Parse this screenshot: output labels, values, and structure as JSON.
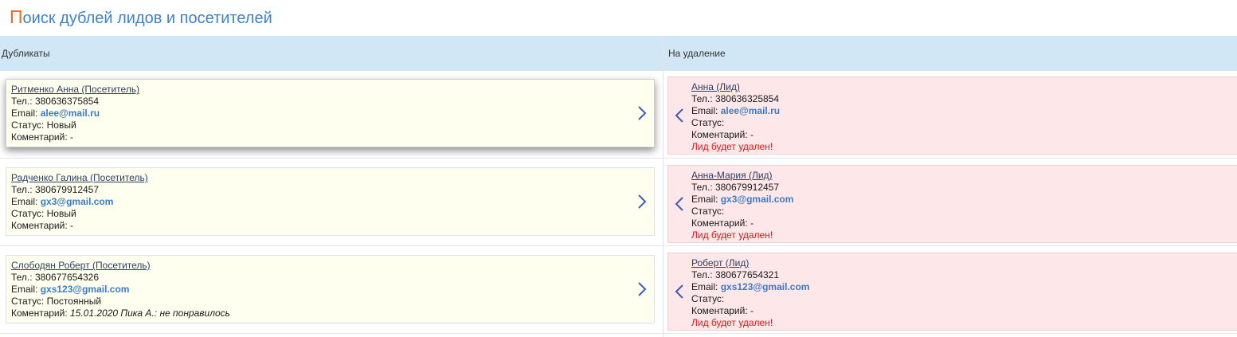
{
  "page": {
    "title_first": "П",
    "title_rest": "оиск дублей лидов и посетителей"
  },
  "header": {
    "duplicates": "Дубликаты",
    "to_delete": "На удаление"
  },
  "labels": {
    "phone": "Тел.: ",
    "email": "Email: ",
    "status": "Статус: ",
    "comment": "Коментарий: "
  },
  "rows": [
    {
      "duplicate": {
        "name": "Ритменко Анна (Посетитель)",
        "phone": "380636375854",
        "email": "alee@mail.ru",
        "status": "Новый",
        "comment": "-"
      },
      "deletion": {
        "name": "Анна (Лид)",
        "phone": "380636325854",
        "email": "alee@mail.ru",
        "status": "",
        "comment": "-",
        "warning": "Лид будет удален!"
      }
    },
    {
      "duplicate": {
        "name": "Радченко Галина (Посетитель)",
        "phone": "380679912457",
        "email": "gx3@gmail.com",
        "status": "Новый",
        "comment": "-"
      },
      "deletion": {
        "name": "Анна-Мария (Лид)",
        "phone": "380679912457",
        "email": "gx3@gmail.com",
        "status": "",
        "comment": "-",
        "warning": "Лид будет удален!"
      }
    },
    {
      "duplicate": {
        "name": "Слободян Роберт (Посетитель)",
        "phone": "380677654326",
        "email": "gxs123@gmail.com",
        "status": "Постоянный",
        "comment": "15.01.2020 Пика А.: не понравилось"
      },
      "deletion": {
        "name": "Роберт (Лид)",
        "phone": "380677654321",
        "email": "gxs123@gmail.com",
        "status": "",
        "comment": "-",
        "warning": "Лид будет удален!"
      }
    }
  ],
  "icons": {
    "move_right": "chevron-right-icon",
    "move_left": "chevron-left-icon"
  },
  "colors": {
    "title_accent": "#f06a1e",
    "title": "#3c83c8",
    "header_bg": "#d1e7f6",
    "duplicate_bg": "#fffff0",
    "deletion_bg": "#fee7e8",
    "warning": "#e3171b",
    "email": "#3a7cc7"
  }
}
